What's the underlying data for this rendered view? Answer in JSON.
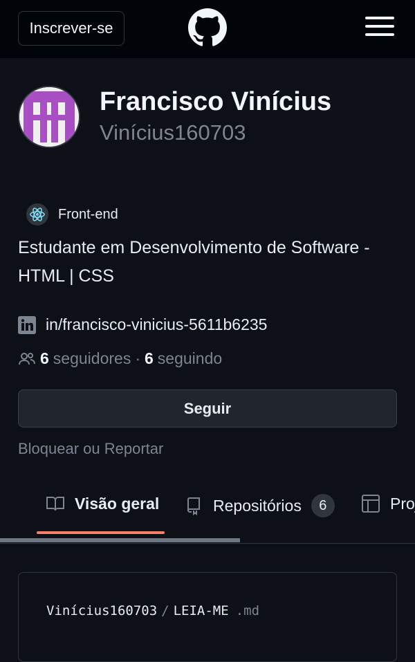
{
  "header": {
    "signup_label": "Inscrever-se",
    "logo_icon": "github-octocat-icon",
    "menu_icon": "hamburger-menu-icon"
  },
  "profile": {
    "avatar_icon": "identicon-avatar",
    "avatar_color": "#a94fc4",
    "full_name": "Francisco Vinícius",
    "username": "Vinícius160703",
    "status_icon": "atom-emoji-icon",
    "status_text": "Front-end",
    "bio": "Estudante em Desenvolvimento de Software - HTML | CSS",
    "linkedin_icon": "linkedin-icon",
    "linkedin_text": "in/francisco-vinicius-5611b6235",
    "followers_count": "6",
    "followers_label": "seguidores",
    "separator": "·",
    "following_count": "6",
    "following_label": "seguindo",
    "follow_label": "Seguir",
    "block_label": "Bloquear ou Reportar"
  },
  "tabs": [
    {
      "label": "Visão geral",
      "icon": "book-icon",
      "selected": true
    },
    {
      "label": "Repositórios",
      "icon": "repo-icon",
      "counter": "6"
    },
    {
      "label": "Projetos",
      "icon": "table-icon"
    }
  ],
  "readme": {
    "owner": "Vinícius160703",
    "separator": "/",
    "name": "LEIA-ME",
    "ext": ".md"
  },
  "colors": {
    "background": "#0d1117",
    "header_bg": "#010409",
    "accent_underline": "#f78166",
    "muted_text": "#7d8590"
  }
}
